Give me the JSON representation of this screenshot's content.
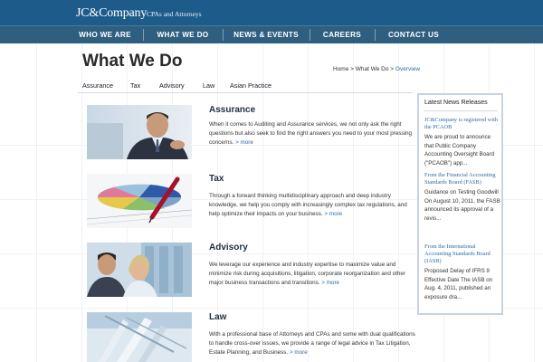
{
  "header": {
    "logo": "JC&Company",
    "tagline": "CPAs and Attorneys"
  },
  "nav": [
    "WHO WE ARE",
    "WHAT WE DO",
    "NEWS & EVENTS",
    "CAREERS",
    "CONTACT US"
  ],
  "page": {
    "title": "What We Do",
    "breadcrumb": {
      "home": "Home",
      "sep1": " > ",
      "section": "What We Do",
      "sep2": " > ",
      "current": "Overview"
    }
  },
  "subnav": [
    "Assurance",
    "Tax",
    "Advisory",
    "Law",
    "Asian Practice"
  ],
  "sections": [
    {
      "heading": "Assurance",
      "text": "When it comes to Auditing and Assurance services, we not only ask the right questions but also seek to find the right answers you need to your most pressing concerns.",
      "more": "> more"
    },
    {
      "heading": "Tax",
      "text": "Through a forward thinking multidisciplinary approach and deep industry knowledge, we help you comply with increasingly complex tax regulations, and help optimize their impacts on your business.",
      "more": "> more"
    },
    {
      "heading": "Advisory",
      "text": "We leverage our experience and industry expertise to maximize value and minimize risk during acquisitions, litigation, corporate reorganization and other major business transactions and transitions.",
      "more": "> more"
    },
    {
      "heading": "Law",
      "text": "With a professional base of Attorneys and CPAs and some with dual qualifications to handle cross-over issues, we provide a range of legal advice in Tax Litigation, Estate Planning, and Business.",
      "more": "> more"
    }
  ],
  "news": {
    "heading": "Latest News Releases",
    "items": [
      {
        "title": "JC&Company is registered with the PCAOB",
        "text": "We are proud to announce that Public Company Accounting Oversight Board (\"PCAOB\") app..."
      },
      {
        "title": "From the Financial Accounting Standards Board (FASB)",
        "text": "Guidance on Testing Goodwill On August 10, 2011, the FASB announced its approval of a revis..."
      },
      {
        "title": "From the International Accounting Standards Board (IASB)",
        "text": "Proposed Delay of IFRS 9 Effective Date The IASB on Aug. 4, 2011, published an exposure dra..."
      }
    ]
  },
  "colors": {
    "header_bg": "#1d5c8a",
    "nav_bg": "#2f5f80",
    "link": "#2f6aa6"
  }
}
